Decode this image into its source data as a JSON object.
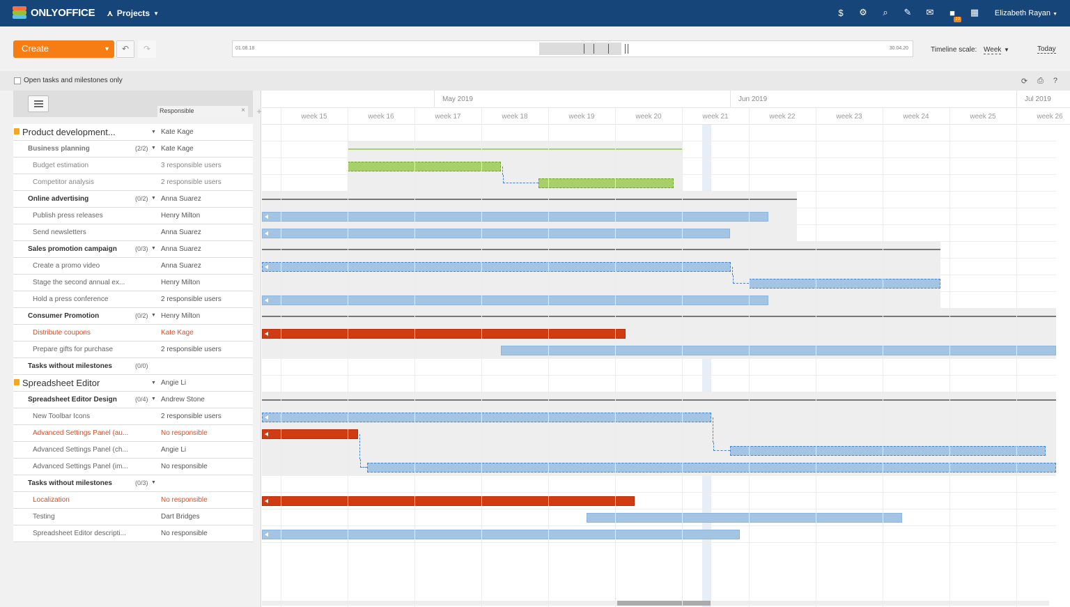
{
  "topbar": {
    "logo_text": "ONLYOFFICE",
    "module": "Projects",
    "user": "Elizabeth Rayan",
    "notification_count": "19",
    "icons": [
      "dollar-icon",
      "gear-icon",
      "search-icon",
      "feed-icon",
      "mail-icon",
      "chat-icon",
      "calendar-icon"
    ]
  },
  "toolbar": {
    "create_label": "Create",
    "timeline_start": "01.08.18",
    "timeline_end": "30.04.20",
    "scale_label": "Timeline scale:",
    "scale_value": "Week",
    "today_label": "Today"
  },
  "filter": {
    "label": "Open tasks and milestones only"
  },
  "columns": {
    "responsible": "Responsible"
  },
  "months": [
    "May 2019",
    "Jun 2019",
    "Jul 2019"
  ],
  "weeks": [
    "week 15",
    "week 16",
    "week 17",
    "week 18",
    "week 19",
    "week 20",
    "week 21",
    "week 22",
    "week 23",
    "week 24",
    "week 25",
    "week 26"
  ],
  "rows": [
    {
      "type": "project",
      "name": "Product development...",
      "count": "",
      "responsible": "Kate Kage"
    },
    {
      "type": "milestone",
      "name": "Business planning",
      "count": "(2/2)",
      "responsible": "Kate Kage",
      "closed": true
    },
    {
      "type": "task",
      "name": "Budget estimation",
      "count": "",
      "responsible": "3 responsible users",
      "closed": true
    },
    {
      "type": "task",
      "name": "Competitor analysis",
      "count": "",
      "responsible": "2 responsible users",
      "closed": true
    },
    {
      "type": "milestone",
      "name": "Online advertising",
      "count": "(0/2)",
      "responsible": "Anna Suarez"
    },
    {
      "type": "task",
      "name": "Publish press releases",
      "count": "",
      "responsible": "Henry Milton"
    },
    {
      "type": "task",
      "name": "Send newsletters",
      "count": "",
      "responsible": "Anna Suarez"
    },
    {
      "type": "milestone",
      "name": "Sales promotion campaign",
      "count": "(0/3)",
      "responsible": "Anna Suarez"
    },
    {
      "type": "task",
      "name": "Create a promo video",
      "count": "",
      "responsible": "Anna Suarez"
    },
    {
      "type": "task",
      "name": "Stage the second annual ex...",
      "count": "",
      "responsible": "Henry Milton"
    },
    {
      "type": "task",
      "name": "Hold a press conference",
      "count": "",
      "responsible": "2 responsible users"
    },
    {
      "type": "milestone",
      "name": "Consumer Promotion",
      "count": "(0/2)",
      "responsible": "Henry Milton"
    },
    {
      "type": "task",
      "name": "Distribute coupons",
      "count": "",
      "responsible": "Kate Kage",
      "overdue": true
    },
    {
      "type": "task",
      "name": "Prepare gifts for purchase",
      "count": "",
      "responsible": "2 responsible users"
    },
    {
      "type": "milestone",
      "name": "Tasks without milestones",
      "count": "(0/0)",
      "responsible": ""
    },
    {
      "type": "project",
      "name": "Spreadsheet Editor",
      "count": "",
      "responsible": "Angie Li"
    },
    {
      "type": "milestone",
      "name": "Spreadsheet Editor Design",
      "count": "(0/4)",
      "responsible": "Andrew Stone"
    },
    {
      "type": "task",
      "name": "New Toolbar Icons",
      "count": "",
      "responsible": "2 responsible users"
    },
    {
      "type": "task",
      "name": "Advanced Settings Panel (au...",
      "count": "",
      "responsible": "No responsible",
      "overdue": true
    },
    {
      "type": "task",
      "name": "Advanced Settings Panel (ch...",
      "count": "",
      "responsible": "Angie Li"
    },
    {
      "type": "task",
      "name": "Advanced Settings Panel (im...",
      "count": "",
      "responsible": "No responsible"
    },
    {
      "type": "milestone",
      "name": "Tasks without milestones",
      "count": "(0/3)",
      "responsible": ""
    },
    {
      "type": "task",
      "name": "Localization",
      "count": "",
      "responsible": "No responsible",
      "overdue": true
    },
    {
      "type": "task",
      "name": "Testing",
      "count": "",
      "responsible": "Dart Bridges"
    },
    {
      "type": "task",
      "name": "Spreadsheet Editor descripti...",
      "count": "",
      "responsible": "No responsible"
    }
  ],
  "colors": {
    "header": "#16457a",
    "accent": "#f57d14",
    "task_bar": "#a3c4e3",
    "overdue_bar": "#d13b12",
    "closed_bar": "#a7cf6a",
    "overdue_text": "#e04b1f"
  }
}
